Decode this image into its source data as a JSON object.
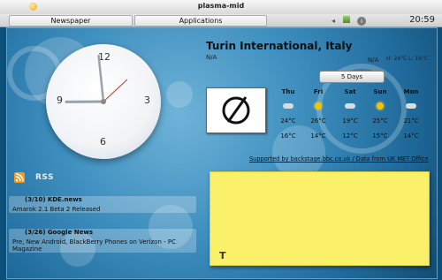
{
  "window": {
    "title": "plasma-mid",
    "buttons": [
      "◂",
      "▭",
      "ⓘ"
    ]
  },
  "panel": {
    "tabs": [
      {
        "label": "Newspaper"
      },
      {
        "label": "Applications"
      }
    ],
    "clock": "20:59"
  },
  "clock": {
    "numbers": {
      "twelve": "12",
      "three": "3",
      "six": "6",
      "nine": "9"
    },
    "hours": 20,
    "minutes": 59
  },
  "weather": {
    "location": "Turin International, Italy",
    "conditions": "N/A",
    "current": "N/A",
    "hilo": "H: 24°C L: 16°C",
    "days_button": "5 Days",
    "forecast": [
      {
        "day": "Thu",
        "icon": "cloud-rain-icon",
        "high": "24°C",
        "low": "16°C"
      },
      {
        "day": "Fri",
        "icon": "sun-icon",
        "high": "26°C",
        "low": "14°C"
      },
      {
        "day": "Sat",
        "icon": "cloud-rain-icon",
        "high": "19°C",
        "low": "12°C"
      },
      {
        "day": "Sun",
        "icon": "sun-icon",
        "high": "25°C",
        "low": "15°C"
      },
      {
        "day": "Mon",
        "icon": "cloud-rain-icon",
        "high": "21°C",
        "low": "14°C"
      }
    ],
    "credits": "Supported by backstage.bbc.co.uk / Data from UK MET Office"
  },
  "rss": {
    "title": "RSS",
    "items": [
      {
        "date": "(3/10)",
        "source": "KDE.news",
        "headline": "Amarok 2.1 Beta 2 Released"
      },
      {
        "date": "(3/26)",
        "source": "Google News",
        "headline": "Pre, New Android, BlackBerry Phones on Verizon - PC Magazine"
      }
    ]
  },
  "note": {
    "format_icon": "T"
  },
  "colors": {
    "desktop": "#3e8fbf",
    "note": "#faf06a",
    "rss": "#f29b1d"
  }
}
